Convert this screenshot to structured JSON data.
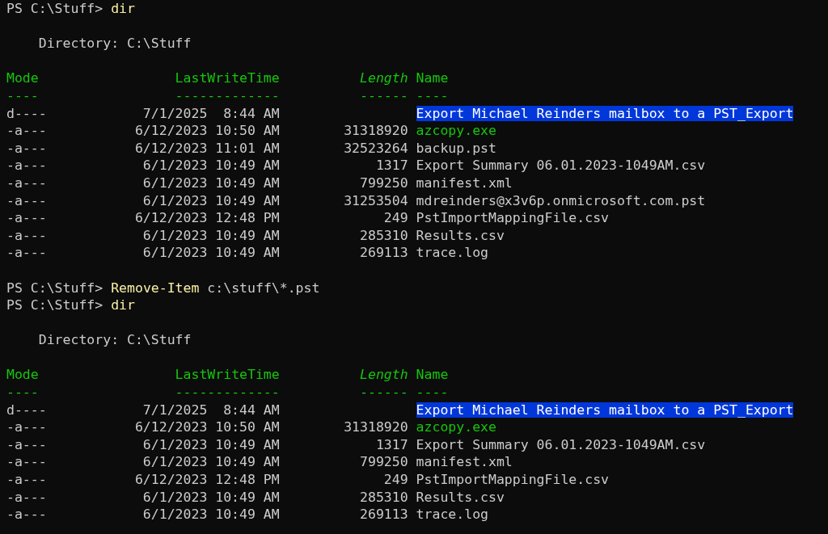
{
  "blocks": [
    {
      "kind": "prompt",
      "prompt": "PS C:\\Stuff>",
      "command": "dir"
    },
    {
      "kind": "listing",
      "directory": "Directory: C:\\Stuff",
      "columns": [
        {
          "label": "Mode",
          "underline": "----",
          "italic": false
        },
        {
          "label": "LastWriteTime",
          "underline": "-------------",
          "italic": false
        },
        {
          "label": "Length",
          "underline": "------",
          "italic": true
        },
        {
          "label": "Name",
          "underline": "----",
          "italic": false
        }
      ],
      "rows": [
        {
          "mode": "d----",
          "time": "7/1/2025  8:44 AM",
          "length": "",
          "name": "Export Michael Reinders mailbox to a PST_Export",
          "kind": "directory"
        },
        {
          "mode": "-a---",
          "time": "6/12/2023 10:50 AM",
          "length": "31318920",
          "name": "azcopy.exe",
          "kind": "executable"
        },
        {
          "mode": "-a---",
          "time": "6/12/2023 11:01 AM",
          "length": "32523264",
          "name": "backup.pst",
          "kind": "file"
        },
        {
          "mode": "-a---",
          "time": "6/1/2023 10:49 AM",
          "length": "1317",
          "name": "Export Summary 06.01.2023-1049AM.csv",
          "kind": "file"
        },
        {
          "mode": "-a---",
          "time": "6/1/2023 10:49 AM",
          "length": "799250",
          "name": "manifest.xml",
          "kind": "file"
        },
        {
          "mode": "-a---",
          "time": "6/1/2023 10:49 AM",
          "length": "31253504",
          "name": "mdreinders@x3v6p.onmicrosoft.com.pst",
          "kind": "file"
        },
        {
          "mode": "-a---",
          "time": "6/12/2023 12:48 PM",
          "length": "249",
          "name": "PstImportMappingFile.csv",
          "kind": "file"
        },
        {
          "mode": "-a---",
          "time": "6/1/2023 10:49 AM",
          "length": "285310",
          "name": "Results.csv",
          "kind": "file"
        },
        {
          "mode": "-a---",
          "time": "6/1/2023 10:49 AM",
          "length": "269113",
          "name": "trace.log",
          "kind": "file"
        }
      ]
    },
    {
      "kind": "prompt",
      "prompt": "PS C:\\Stuff>",
      "command": "Remove-Item",
      "args": "c:\\stuff\\*.pst"
    },
    {
      "kind": "prompt",
      "prompt": "PS C:\\Stuff>",
      "command": "dir"
    },
    {
      "kind": "listing",
      "directory": "Directory: C:\\Stuff",
      "columns": [
        {
          "label": "Mode",
          "underline": "----",
          "italic": false
        },
        {
          "label": "LastWriteTime",
          "underline": "-------------",
          "italic": false
        },
        {
          "label": "Length",
          "underline": "------",
          "italic": true
        },
        {
          "label": "Name",
          "underline": "----",
          "italic": false
        }
      ],
      "rows": [
        {
          "mode": "d----",
          "time": "7/1/2025  8:44 AM",
          "length": "",
          "name": "Export Michael Reinders mailbox to a PST_Export",
          "kind": "directory"
        },
        {
          "mode": "-a---",
          "time": "6/12/2023 10:50 AM",
          "length": "31318920",
          "name": "azcopy.exe",
          "kind": "executable"
        },
        {
          "mode": "-a---",
          "time": "6/1/2023 10:49 AM",
          "length": "1317",
          "name": "Export Summary 06.01.2023-1049AM.csv",
          "kind": "file"
        },
        {
          "mode": "-a---",
          "time": "6/1/2023 10:49 AM",
          "length": "799250",
          "name": "manifest.xml",
          "kind": "file"
        },
        {
          "mode": "-a---",
          "time": "6/12/2023 12:48 PM",
          "length": "249",
          "name": "PstImportMappingFile.csv",
          "kind": "file"
        },
        {
          "mode": "-a---",
          "time": "6/1/2023 10:49 AM",
          "length": "285310",
          "name": "Results.csv",
          "kind": "file"
        },
        {
          "mode": "-a---",
          "time": "6/1/2023 10:49 AM",
          "length": "269113",
          "name": "trace.log",
          "kind": "file"
        }
      ]
    }
  ]
}
